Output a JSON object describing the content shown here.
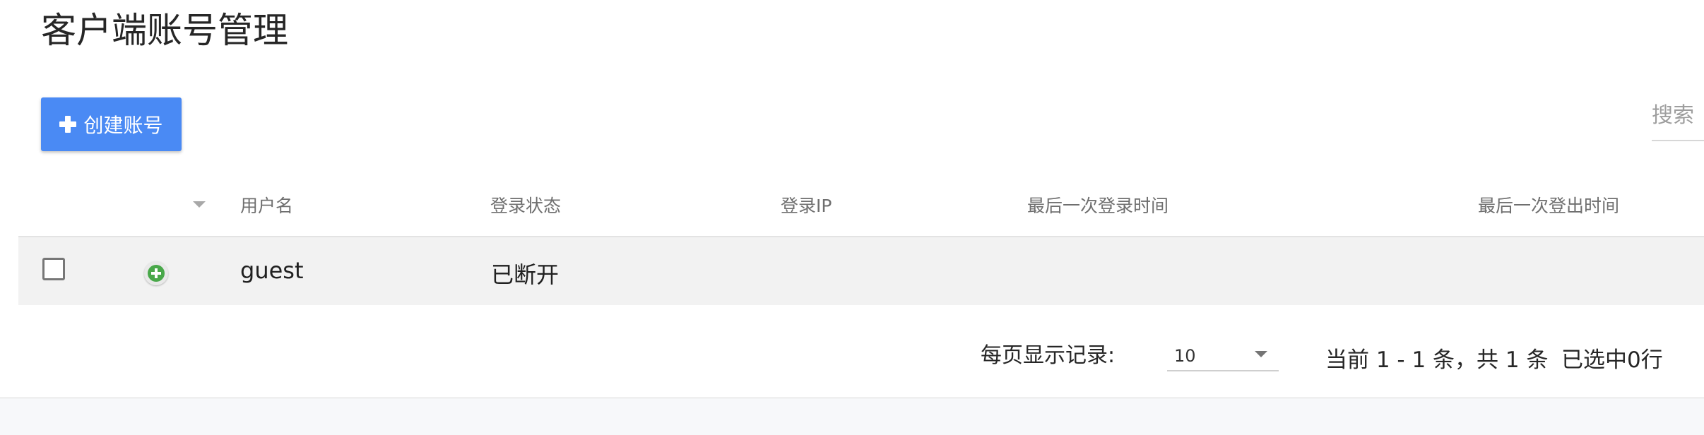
{
  "page": {
    "title": "客户端账号管理"
  },
  "toolbar": {
    "create_label": "创建账号",
    "create_icon": "plus-icon",
    "search_placeholder": "搜索"
  },
  "table": {
    "columns": [
      "用户名",
      "登录状态",
      "登录IP",
      "最后一次登录时间",
      "最后一次登出时间"
    ],
    "rows": [
      {
        "checked": false,
        "expand_icon": "green-plus-circle-icon",
        "username": "guest",
        "status": "已断开",
        "ip": "",
        "last_login": "",
        "last_logout": ""
      }
    ]
  },
  "pagination": {
    "page_size_label": "每页显示记录:",
    "page_size": "10",
    "range_text": "当前 1 - 1 条，共 1 条",
    "selected_text": "已选中0行"
  },
  "colors": {
    "primary": "#4a8af4",
    "expand_green": "#49a84a",
    "row_background": "#f2f2f2"
  }
}
